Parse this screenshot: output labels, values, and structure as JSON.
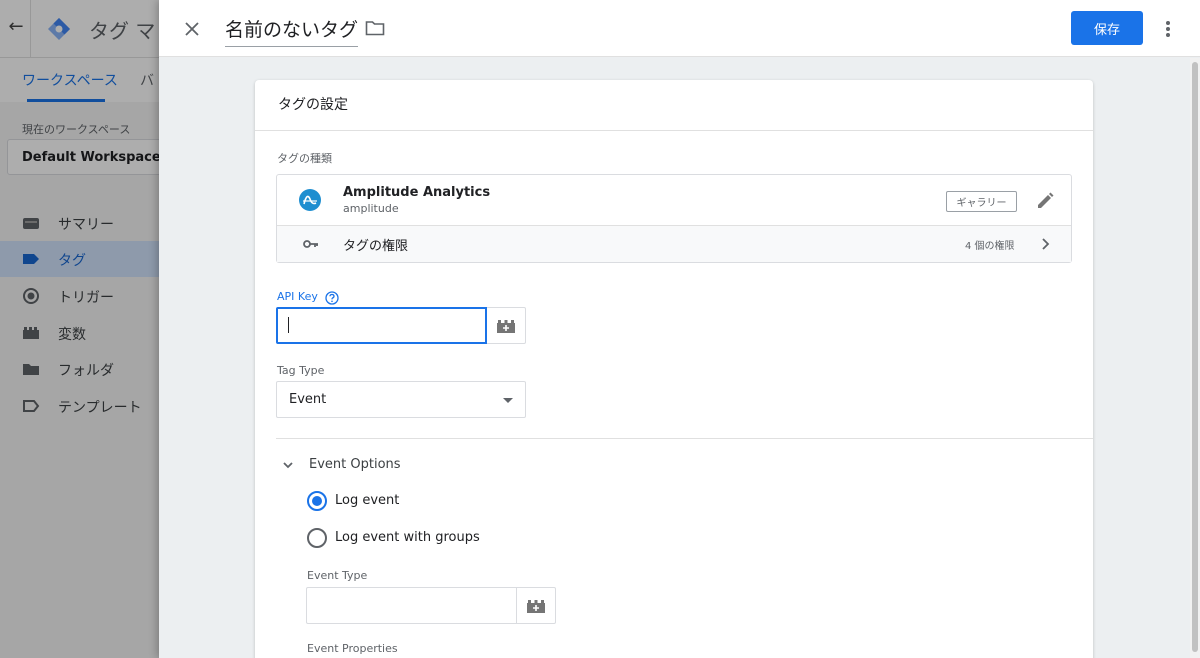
{
  "background": {
    "back_icon": "arrow-left-icon",
    "app_title": "タグ マ",
    "tabs": [
      "ワークスペース",
      "バ"
    ],
    "workspace_label": "現在のワークスペース",
    "workspace_name": "Default Workspace",
    "nav": [
      {
        "label": "サマリー",
        "icon": "summary-icon"
      },
      {
        "label": "タグ",
        "icon": "tag-icon",
        "active": true
      },
      {
        "label": "トリガー",
        "icon": "trigger-icon"
      },
      {
        "label": "変数",
        "icon": "variable-icon"
      },
      {
        "label": "フォルダ",
        "icon": "folder-icon"
      },
      {
        "label": "テンプレート",
        "icon": "template-icon"
      }
    ]
  },
  "drawer": {
    "tag_name": "名前のないタグ",
    "save_label": "保存"
  },
  "card": {
    "title": "タグの設定",
    "tag_type_label": "タグの種類",
    "tag_type": {
      "name": "Amplitude Analytics",
      "sub": "amplitude",
      "gallery_label": "ギャラリー"
    },
    "permissions": {
      "label": "タグの権限",
      "count": "4 個の権限"
    },
    "api_key": {
      "label": "API Key",
      "value": ""
    },
    "tag_type_field": {
      "label": "Tag Type",
      "value": "Event"
    },
    "event_options": {
      "title": "Event Options",
      "options": [
        "Log event",
        "Log event with groups"
      ],
      "selected": 0,
      "event_type_label": "Event Type",
      "event_type_value": "",
      "event_properties_label": "Event Properties"
    }
  },
  "colors": {
    "accent": "#1a73e8",
    "amplitude": "#1e8ed0"
  }
}
